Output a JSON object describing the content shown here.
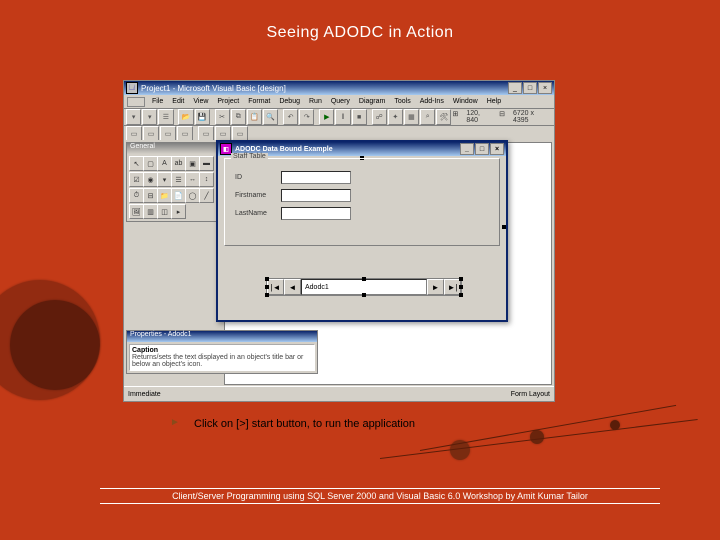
{
  "slide": {
    "title": "Seeing ADODC in Action",
    "bullet_icon": "►",
    "bullet_text": "Click on [>] start button, to run the application",
    "footer": "Client/Server Programming using SQL Server 2000 and Visual Basic 6.0 Workshop by Amit Kumar Tailor"
  },
  "ide": {
    "title": "Project1 - Microsoft Visual Basic [design]",
    "menu": [
      "File",
      "Edit",
      "View",
      "Project",
      "Format",
      "Debug",
      "Run",
      "Query",
      "Diagram",
      "Tools",
      "Add-Ins",
      "Window",
      "Help"
    ],
    "status_pos": "120, 840",
    "status_size": "6720 x 4395",
    "toolbox_title": "General",
    "props_title": "Properties - Adodc1",
    "props_caption_label": "Caption",
    "props_caption_desc": "Returns/sets the text displayed in an object's title bar or below an object's icon.",
    "status_left": "Immediate",
    "status_right": "Form Layout",
    "win_buttons": {
      "min": "_",
      "max": "□",
      "close": "×"
    }
  },
  "form": {
    "title": "ADODC Data Bound Example",
    "group_label": "Staff Table",
    "row1": "ID",
    "row2": "Firstname",
    "row3": "LastName",
    "adodc_caption": "Adodc1",
    "nav": {
      "first": "|◄",
      "prev": "◄",
      "next": "►",
      "last": "►|"
    }
  }
}
